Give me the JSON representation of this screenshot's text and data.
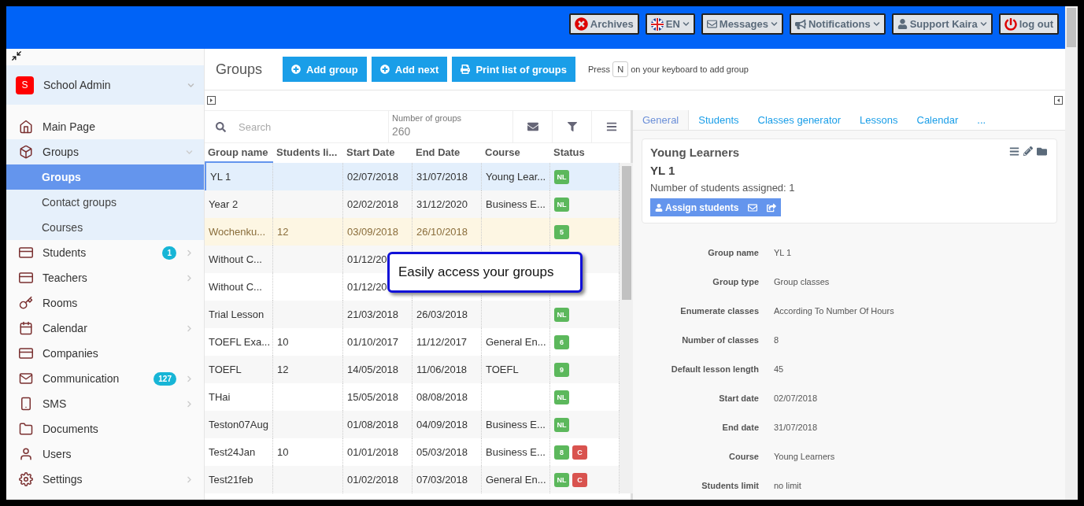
{
  "topbar": {
    "buttons": [
      {
        "label": "Archives",
        "dropdown": false
      },
      {
        "label": "EN",
        "dropdown": true
      },
      {
        "label": "Messages",
        "dropdown": true
      },
      {
        "label": "Notifications",
        "dropdown": true
      },
      {
        "label": "Support Kaira",
        "dropdown": true
      },
      {
        "label": "log out",
        "dropdown": false
      }
    ]
  },
  "sidebar": {
    "school": {
      "initial": "S",
      "name": "School Admin"
    },
    "items": [
      {
        "label": "Main Page",
        "expanded": false,
        "has_submenu": false
      },
      {
        "label": "Groups",
        "expanded": true,
        "has_submenu": true,
        "children": [
          {
            "label": "Groups",
            "selected": true
          },
          {
            "label": "Contact groups",
            "selected": false
          },
          {
            "label": "Courses",
            "selected": false
          }
        ]
      },
      {
        "label": "Students",
        "expanded": false,
        "has_submenu": true,
        "badge": "1"
      },
      {
        "label": "Teachers",
        "expanded": false,
        "has_submenu": true
      },
      {
        "label": "Rooms",
        "expanded": false,
        "has_submenu": false
      },
      {
        "label": "Calendar",
        "expanded": false,
        "has_submenu": true
      },
      {
        "label": "Companies",
        "expanded": false,
        "has_submenu": false
      },
      {
        "label": "Communication",
        "expanded": false,
        "has_submenu": true,
        "badge": "127"
      },
      {
        "label": "SMS",
        "expanded": false,
        "has_submenu": true
      },
      {
        "label": "Documents",
        "expanded": false,
        "has_submenu": false
      },
      {
        "label": "Users",
        "expanded": false,
        "has_submenu": false
      },
      {
        "label": "Settings",
        "expanded": false,
        "has_submenu": true
      }
    ]
  },
  "header": {
    "title": "Groups",
    "buttons": [
      "Add group",
      "Add next",
      "Print list of groups"
    ],
    "hint_before": "Press",
    "hint_key": "N",
    "hint_after": "on your keyboard to add group"
  },
  "table": {
    "search": {
      "placeholder": "Search"
    },
    "count_label": "Number of groups",
    "count": "260",
    "columns": [
      "Group name",
      "Students li...",
      "Start Date",
      "End Date",
      "Course",
      "Status"
    ],
    "rows": [
      {
        "selected": true,
        "highlighted": false,
        "cells": [
          "YL 1",
          "",
          "02/07/2018",
          "31/07/2018",
          "Young Lear..."
        ],
        "status": [
          {
            "text": "NL",
            "color": "#5cb85c"
          }
        ]
      },
      {
        "selected": false,
        "highlighted": false,
        "cells": [
          "Year 2",
          "",
          "02/02/2018",
          "31/12/2020",
          "Business E..."
        ],
        "status": [
          {
            "text": "NL",
            "color": "#5cb85c"
          }
        ]
      },
      {
        "selected": false,
        "highlighted": true,
        "cells": [
          "Wochenku...",
          "12",
          "03/09/2018",
          "26/10/2018",
          ""
        ],
        "status": [
          {
            "text": "5",
            "color": "#5cb85c"
          }
        ]
      },
      {
        "selected": false,
        "highlighted": false,
        "cells": [
          "Without C...",
          "",
          "01/12/20",
          "",
          ""
        ]
      },
      {
        "selected": false,
        "highlighted": false,
        "cells": [
          "Without C...",
          "",
          "01/12/20",
          "",
          ""
        ]
      },
      {
        "selected": false,
        "highlighted": false,
        "cells": [
          "Trial Lesson",
          "",
          "21/03/2018",
          "26/03/2018",
          ""
        ],
        "status": [
          {
            "text": "NL",
            "color": "#5cb85c"
          }
        ]
      },
      {
        "selected": false,
        "highlighted": false,
        "cells": [
          "TOEFL Exa...",
          "10",
          "01/10/2017",
          "11/12/2017",
          "General En..."
        ],
        "status": [
          {
            "text": "6",
            "color": "#5cb85c"
          }
        ]
      },
      {
        "selected": false,
        "highlighted": false,
        "cells": [
          "TOEFL",
          "12",
          "14/05/2018",
          "11/06/2018",
          "TOEFL"
        ],
        "status": [
          {
            "text": "9",
            "color": "#5cb85c"
          }
        ]
      },
      {
        "selected": false,
        "highlighted": false,
        "cells": [
          "THai",
          "",
          "15/05/2018",
          "08/08/2018",
          ""
        ],
        "status": [
          {
            "text": "NL",
            "color": "#5cb85c"
          }
        ]
      },
      {
        "selected": false,
        "highlighted": false,
        "cells": [
          "Teston07Aug",
          "",
          "01/08/2018",
          "04/09/2018",
          "Business E..."
        ],
        "status": [
          {
            "text": "NL",
            "color": "#5cb85c"
          }
        ]
      },
      {
        "selected": false,
        "highlighted": false,
        "cells": [
          "Test24Jan",
          "10",
          "01/01/2018",
          "05/03/2018",
          "Business E..."
        ],
        "status": [
          {
            "text": "8",
            "color": "#5cb85c"
          },
          {
            "text": "C",
            "color": "#d9534f"
          }
        ]
      },
      {
        "selected": false,
        "highlighted": false,
        "cells": [
          "Test21feb",
          "",
          "01/02/2018",
          "07/03/2018",
          "General En..."
        ],
        "status": [
          {
            "text": "NL",
            "color": "#5cb85c"
          },
          {
            "text": "C",
            "color": "#d9534f"
          }
        ]
      }
    ]
  },
  "callout": "Easily access your groups",
  "details": {
    "tabs": [
      {
        "label": "General",
        "selected": true
      },
      {
        "label": "Students",
        "selected": false
      },
      {
        "label": "Classes generator",
        "selected": false
      },
      {
        "label": "Lessons",
        "selected": false
      },
      {
        "label": "Calendar",
        "selected": false
      },
      {
        "label": "...",
        "selected": false
      }
    ],
    "card": {
      "course": "Young Learners",
      "group": "YL 1",
      "assigned": "Number of students assigned: 1",
      "assign_button": "Assign students"
    },
    "fields": [
      {
        "label": "Group name",
        "value": "YL 1"
      },
      {
        "label": "Group type",
        "value": "Group classes"
      },
      {
        "label": "Enumerate classes",
        "value": "According To Number Of Hours"
      },
      {
        "label": "Number of classes",
        "value": "8"
      },
      {
        "label": "Default lesson length",
        "value": "45"
      },
      {
        "label": "Start date",
        "value": "02/07/2018"
      },
      {
        "label": "End date",
        "value": "31/07/2018"
      },
      {
        "label": "Course",
        "value": "Young Learners"
      },
      {
        "label": "Students limit",
        "value": "no limit"
      }
    ]
  }
}
